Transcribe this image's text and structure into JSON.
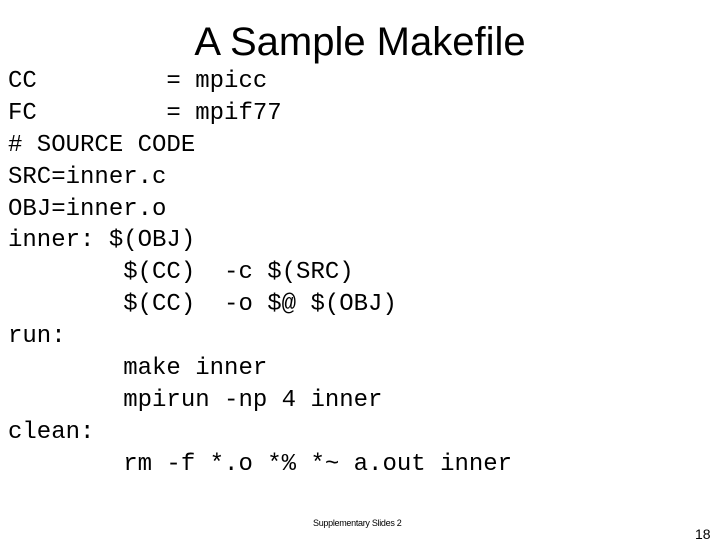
{
  "slide": {
    "title": "A Sample Makefile",
    "code_lines": [
      "CC         = mpicc",
      "FC         = mpif77",
      "# SOURCE CODE",
      "SRC=inner.c",
      "OBJ=inner.o",
      "inner: $(OBJ)",
      "        $(CC)  -c $(SRC)",
      "        $(CC)  -o $@ $(OBJ)",
      "run:",
      "        make inner",
      "        mpirun -np 4 inner",
      "clean:",
      "        rm -f *.o *% *~ a.out inner"
    ],
    "footer": "Supplementary Slides 2",
    "page_number": "18"
  }
}
